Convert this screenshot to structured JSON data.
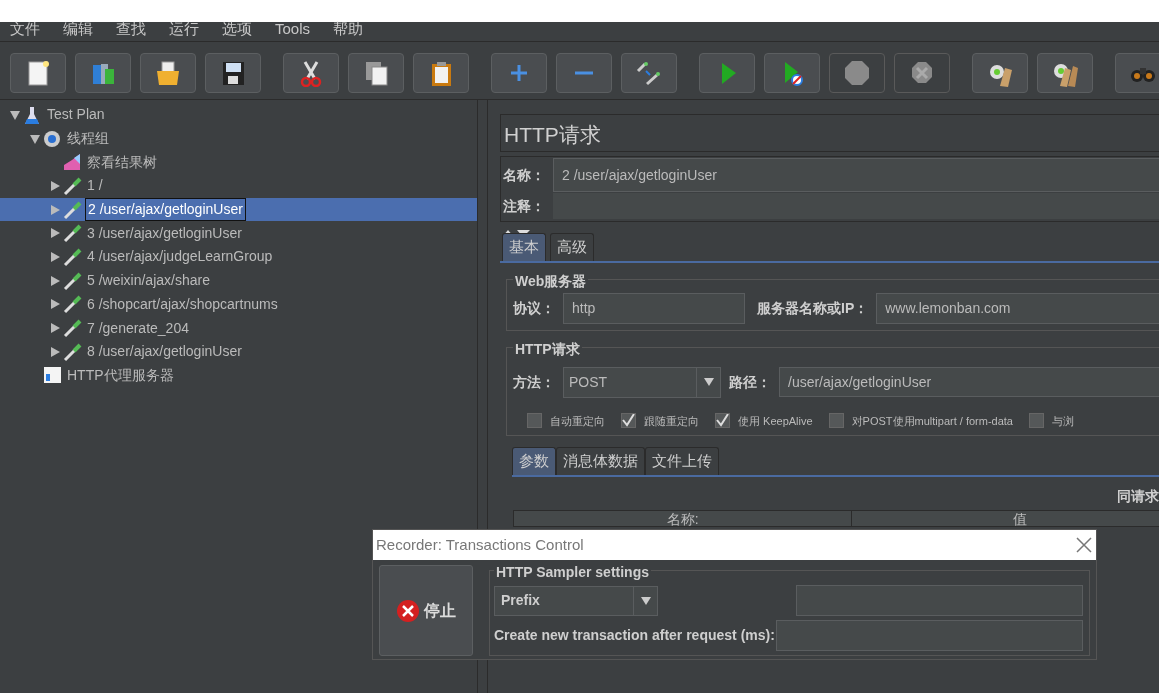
{
  "menu": [
    {
      "label": "文件"
    },
    {
      "label": "编辑"
    },
    {
      "label": "查找"
    },
    {
      "label": "运行"
    },
    {
      "label": "选项"
    },
    {
      "label": "Tools"
    },
    {
      "label": "帮助"
    }
  ],
  "toolbar": [
    [
      {
        "disabled": false
      },
      {
        "disabled": false
      },
      {
        "disabled": false
      },
      {
        "disabled": false
      }
    ],
    [
      {
        "disabled": false
      },
      {
        "disabled": false
      },
      {
        "disabled": false
      }
    ],
    [
      {
        "disabled": false
      },
      {
        "disabled": false
      },
      {
        "disabled": false
      }
    ],
    [
      {
        "disabled": false
      },
      {
        "disabled": false
      },
      {
        "disabled": true
      },
      {
        "disabled": true
      }
    ],
    [
      {
        "disabled": false
      },
      {
        "disabled": false
      }
    ],
    [
      {
        "disabled": false
      }
    ]
  ],
  "tree": [
    {
      "label": "Test Plan",
      "kind": "plan",
      "expanded": true,
      "selected": false,
      "children": [
        {
          "label": "线程组",
          "kind": "thread-group",
          "expanded": true,
          "selected": false,
          "children": [
            {
              "label": "察看结果树",
              "kind": "listener",
              "selected": false
            },
            {
              "label": "1 /",
              "kind": "sampler",
              "expanded": false,
              "selected": false
            },
            {
              "label": "2 /user/ajax/getloginUser",
              "kind": "sampler",
              "expanded": false,
              "selected": true
            },
            {
              "label": "3 /user/ajax/getloginUser",
              "kind": "sampler",
              "expanded": false,
              "selected": false
            },
            {
              "label": "4 /user/ajax/judgeLearnGroup",
              "kind": "sampler",
              "expanded": false,
              "selected": false
            },
            {
              "label": "5 /weixin/ajax/share",
              "kind": "sampler",
              "expanded": false,
              "selected": false
            },
            {
              "label": "6 /shopcart/ajax/shopcartnums",
              "kind": "sampler",
              "expanded": false,
              "selected": false
            },
            {
              "label": "7 /generate_204",
              "kind": "sampler",
              "expanded": false,
              "selected": false
            },
            {
              "label": "8 /user/ajax/getloginUser",
              "kind": "sampler",
              "expanded": false,
              "selected": false
            }
          ]
        },
        {
          "label": "HTTP代理服务器",
          "kind": "proxy",
          "selected": false
        }
      ]
    }
  ],
  "editor": {
    "title": "HTTP请求",
    "name": {
      "label": "名称：",
      "value": "2 /user/ajax/getloginUser"
    },
    "comment": {
      "label": "注释："
    },
    "tabs": [
      {
        "label": "基本",
        "selected": true
      },
      {
        "label": "高级",
        "selected": false
      }
    ],
    "web_server": {
      "legend": "Web服务器",
      "protocol": {
        "label": "协议：",
        "value": "http"
      },
      "server": {
        "label": "服务器名称或IP：",
        "value": "www.lemonban.com"
      }
    },
    "http_request": {
      "legend": "HTTP请求",
      "method": {
        "label": "方法：",
        "value": "POST"
      },
      "path": {
        "label": "路径：",
        "value": "/user/ajax/getloginUser"
      },
      "options": [
        {
          "label": "自动重定向",
          "checked": false
        },
        {
          "label": "跟随重定向",
          "checked": true
        },
        {
          "label": "使用 KeepAlive",
          "checked": true
        },
        {
          "label": "对POST使用multipart / form-data",
          "checked": false
        },
        {
          "label": "与浏",
          "checked": false
        }
      ]
    },
    "sub_tabs": [
      {
        "label": "参数",
        "selected": true
      },
      {
        "label": "消息体数据",
        "selected": false
      },
      {
        "label": "文件上传",
        "selected": false
      }
    ],
    "params_caption": "同请求",
    "columns": [
      "名称:",
      "值"
    ]
  },
  "dialog": {
    "title": "Recorder: Transactions Control",
    "stop_button": "停止",
    "legend": "HTTP Sampler settings",
    "naming": {
      "value": "Prefix"
    },
    "transaction_label": "Create new transaction after request (ms):"
  }
}
